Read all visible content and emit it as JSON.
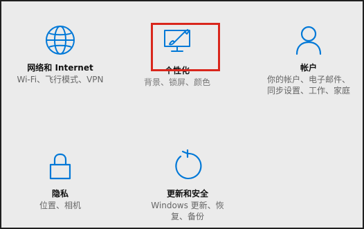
{
  "settings": {
    "network": {
      "title": "网络和 Internet",
      "subtitle": "Wi-Fi、飞行模式、VPN",
      "icon": "globe-icon"
    },
    "personalization": {
      "title": "个性化",
      "subtitle": "背景、锁屏、颜色",
      "icon": "paintbrush-monitor-icon"
    },
    "accounts": {
      "title": "帐户",
      "subtitle_line1": "你的帐户、电子邮件、",
      "subtitle_line2": "同步设置、工作、家庭",
      "icon": "person-icon"
    },
    "privacy": {
      "title": "隐私",
      "subtitle": "位置、相机",
      "icon": "lock-icon"
    },
    "update_security": {
      "title": "更新和安全",
      "subtitle_line1": "Windows 更新、恢",
      "subtitle_line2": "复、备份",
      "icon": "refresh-icon"
    }
  },
  "colors": {
    "accent": "#0078d7",
    "highlight": "#d9261c",
    "background": "#ebebeb",
    "text": "#111111",
    "subtext": "#666666"
  }
}
